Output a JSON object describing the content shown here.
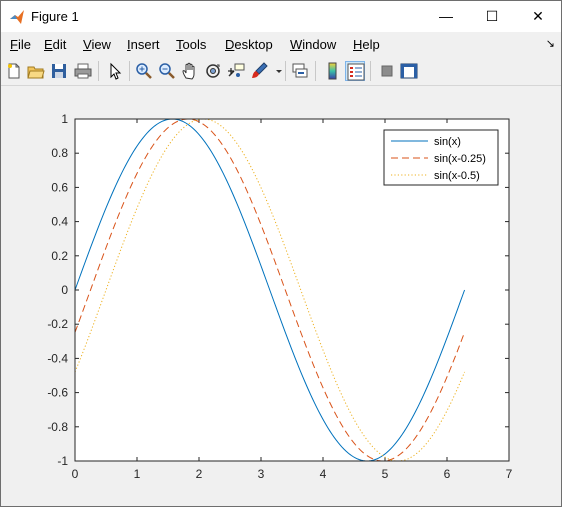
{
  "window": {
    "title": "Figure 1",
    "minimize": "—",
    "maximize": "☐",
    "close": "✕"
  },
  "menu": [
    {
      "label": "File",
      "mnemonic": "F",
      "rest": "ile"
    },
    {
      "label": "Edit",
      "mnemonic": "E",
      "rest": "dit"
    },
    {
      "label": "View",
      "mnemonic": "V",
      "rest": "iew"
    },
    {
      "label": "Insert",
      "mnemonic": "I",
      "rest": "nsert"
    },
    {
      "label": "Tools",
      "mnemonic": "T",
      "rest": "ools"
    },
    {
      "label": "Desktop",
      "mnemonic": "D",
      "rest": "esktop"
    },
    {
      "label": "Window",
      "mnemonic": "W",
      "rest": "indow"
    },
    {
      "label": "Help",
      "mnemonic": "H",
      "rest": "elp"
    }
  ],
  "menu_overflow": "↘",
  "toolbar": [
    "new-figure-icon",
    "open-file-icon",
    "save-icon",
    "print-icon",
    "pointer-icon",
    "zoom-in-icon",
    "zoom-out-icon",
    "pan-icon",
    "rotate-3d-icon",
    "data-cursor-icon",
    "brush-icon",
    "link-plot-icon",
    "colorbar-icon",
    "legend-icon",
    "hide-plot-tools-icon",
    "show-plot-tools-icon"
  ],
  "chart_data": {
    "type": "line",
    "xlim": [
      0,
      7
    ],
    "ylim": [
      -1,
      1
    ],
    "xticks": [
      "0",
      "1",
      "2",
      "3",
      "4",
      "5",
      "6",
      "7"
    ],
    "yticks": [
      "-1",
      "-0.8",
      "-0.6",
      "-0.4",
      "-0.2",
      "0",
      "0.2",
      "0.4",
      "0.6",
      "0.8",
      "1"
    ],
    "x_range": [
      0,
      6.2832
    ],
    "grid": false,
    "legend_position": "top-right",
    "series": [
      {
        "name": "sin(x)",
        "phase": 0,
        "color": "#0072BD",
        "style": "solid"
      },
      {
        "name": "sin(x-0.25)",
        "phase": 0.25,
        "color": "#D95319",
        "style": "dashed"
      },
      {
        "name": "sin(x-0.5)",
        "phase": 0.5,
        "color": "#EDB120",
        "style": "dotted"
      }
    ]
  }
}
